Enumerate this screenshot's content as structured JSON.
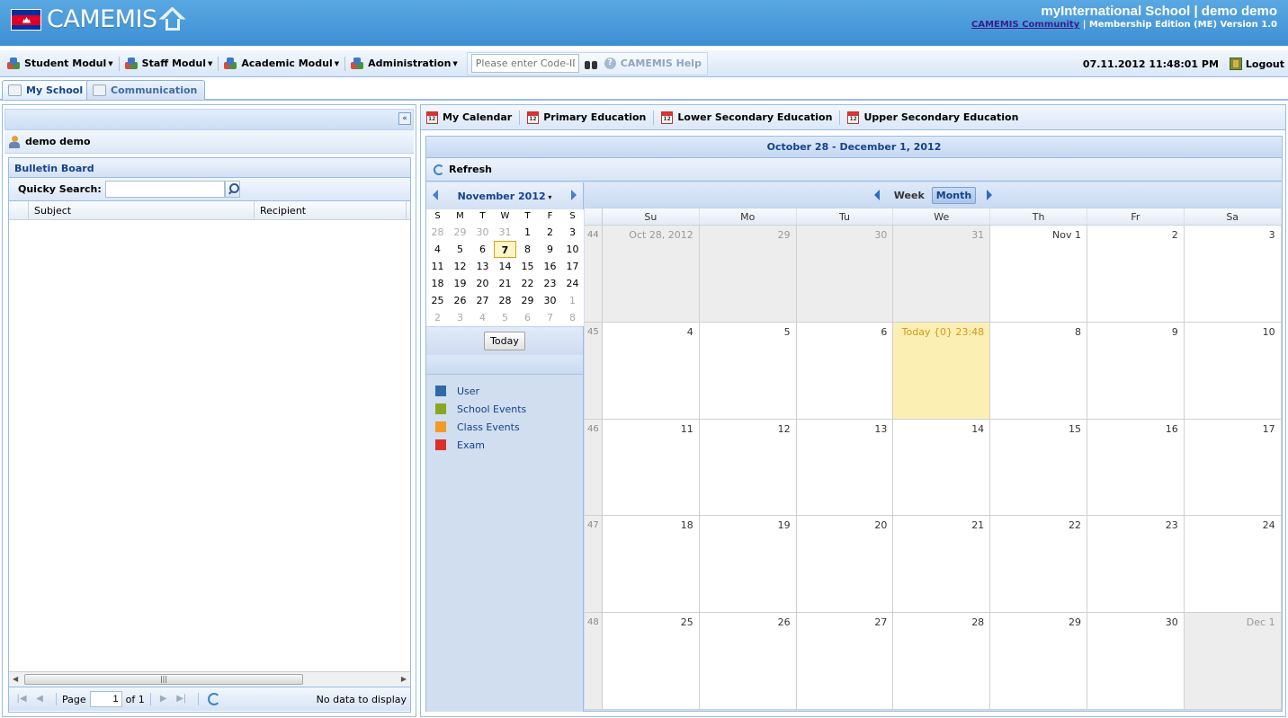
{
  "header": {
    "logo_text": "CAMEMIS",
    "school_title": "myInternational School | demo demo",
    "community_link": "CAMEMIS Community",
    "edition": "| Membership Edition (ME) Version 1.0"
  },
  "toolbar": {
    "menus": [
      "Student Modul",
      "Staff Modul",
      "Academic Modul",
      "Administration"
    ],
    "code_placeholder": "Please enter Code-ID...",
    "help_label": "CAMEMIS Help",
    "datetime": "07.11.2012 11:48:01 PM",
    "logout_label": "Logout"
  },
  "main_tabs": {
    "my_school": "My School",
    "communication": "Communication"
  },
  "left_panel": {
    "user_name": "demo demo",
    "bulletin_title": "Bulletin Board",
    "search_label": "Quicky Search:",
    "columns": [
      "Subject",
      "Recipient"
    ],
    "pager": {
      "page_label": "Page",
      "page_value": "1",
      "of_label": "of 1",
      "status": "No data to display"
    }
  },
  "calendar": {
    "tabs": [
      "My Calendar",
      "Primary Education",
      "Lower Secondary Education",
      "Upper Secondary Education"
    ],
    "range": "October 28 - December 1, 2012",
    "refresh_label": "Refresh",
    "mini": {
      "month_label": "November 2012",
      "dow": [
        "S",
        "M",
        "T",
        "W",
        "T",
        "F",
        "S"
      ],
      "weeks": [
        [
          {
            "d": "28",
            "o": true
          },
          {
            "d": "29",
            "o": true
          },
          {
            "d": "30",
            "o": true
          },
          {
            "d": "31",
            "o": true
          },
          {
            "d": "1"
          },
          {
            "d": "2"
          },
          {
            "d": "3"
          }
        ],
        [
          {
            "d": "4"
          },
          {
            "d": "5"
          },
          {
            "d": "6"
          },
          {
            "d": "7",
            "t": true
          },
          {
            "d": "8"
          },
          {
            "d": "9"
          },
          {
            "d": "10"
          }
        ],
        [
          {
            "d": "11"
          },
          {
            "d": "12"
          },
          {
            "d": "13"
          },
          {
            "d": "14"
          },
          {
            "d": "15"
          },
          {
            "d": "16"
          },
          {
            "d": "17"
          }
        ],
        [
          {
            "d": "18"
          },
          {
            "d": "19"
          },
          {
            "d": "20"
          },
          {
            "d": "21"
          },
          {
            "d": "22"
          },
          {
            "d": "23"
          },
          {
            "d": "24"
          }
        ],
        [
          {
            "d": "25"
          },
          {
            "d": "26"
          },
          {
            "d": "27"
          },
          {
            "d": "28"
          },
          {
            "d": "29"
          },
          {
            "d": "30"
          },
          {
            "d": "1",
            "o": true
          }
        ],
        [
          {
            "d": "2",
            "o": true
          },
          {
            "d": "3",
            "o": true
          },
          {
            "d": "4",
            "o": true
          },
          {
            "d": "5",
            "o": true
          },
          {
            "d": "6",
            "o": true
          },
          {
            "d": "7",
            "o": true
          },
          {
            "d": "8",
            "o": true
          }
        ]
      ],
      "today_label": "Today"
    },
    "legend": [
      {
        "label": "User",
        "color": "#2f6aa8"
      },
      {
        "label": "School Events",
        "color": "#8aa626"
      },
      {
        "label": "Class Events",
        "color": "#f29a26"
      },
      {
        "label": "Exam",
        "color": "#d9302c"
      }
    ],
    "view_week": "Week",
    "view_month": "Month",
    "days": [
      "Su",
      "Mo",
      "Tu",
      "We",
      "Th",
      "Fr",
      "Sa"
    ],
    "month_weeks": [
      {
        "wk": "44",
        "cells": [
          {
            "d": "Oct 28, 2012",
            "o": true
          },
          {
            "d": "29",
            "o": true
          },
          {
            "d": "30",
            "o": true
          },
          {
            "d": "31",
            "o": true
          },
          {
            "d": "Nov 1"
          },
          {
            "d": "2"
          },
          {
            "d": "3"
          }
        ]
      },
      {
        "wk": "45",
        "cells": [
          {
            "d": "4"
          },
          {
            "d": "5"
          },
          {
            "d": "6"
          },
          {
            "d": "Today {0} 23:48",
            "t": true
          },
          {
            "d": "8"
          },
          {
            "d": "9"
          },
          {
            "d": "10"
          }
        ]
      },
      {
        "wk": "46",
        "cells": [
          {
            "d": "11"
          },
          {
            "d": "12"
          },
          {
            "d": "13"
          },
          {
            "d": "14"
          },
          {
            "d": "15"
          },
          {
            "d": "16"
          },
          {
            "d": "17"
          }
        ]
      },
      {
        "wk": "47",
        "cells": [
          {
            "d": "18"
          },
          {
            "d": "19"
          },
          {
            "d": "20"
          },
          {
            "d": "21"
          },
          {
            "d": "22"
          },
          {
            "d": "23"
          },
          {
            "d": "24"
          }
        ]
      },
      {
        "wk": "48",
        "cells": [
          {
            "d": "25"
          },
          {
            "d": "26"
          },
          {
            "d": "27"
          },
          {
            "d": "28"
          },
          {
            "d": "29"
          },
          {
            "d": "30"
          },
          {
            "d": "Dec 1",
            "o": true
          }
        ]
      }
    ]
  }
}
